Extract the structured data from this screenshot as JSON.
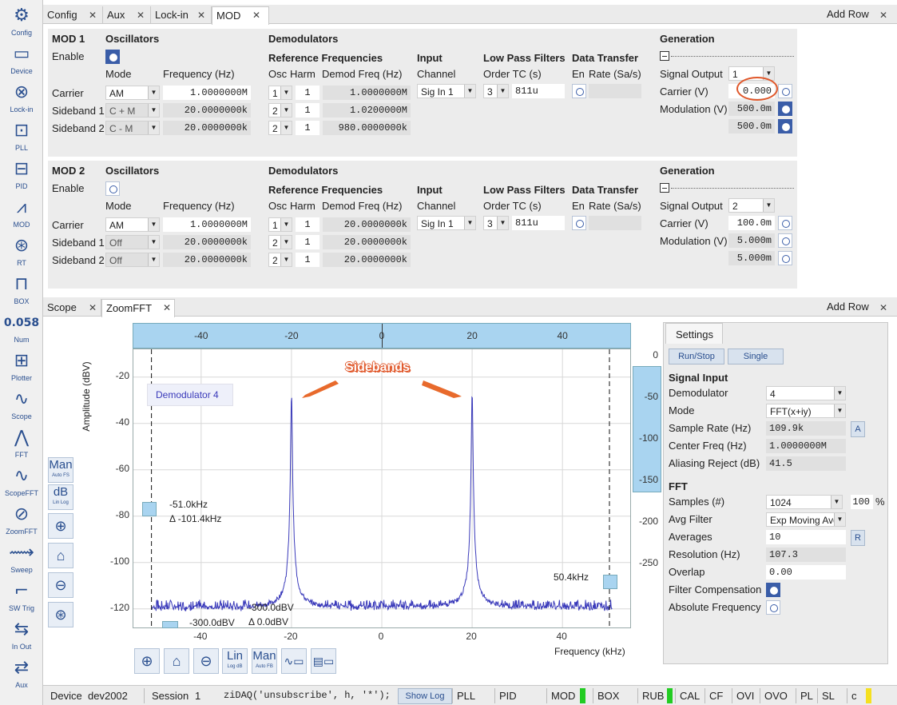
{
  "sidebar": [
    {
      "label": "Config",
      "icon": "gears-icon"
    },
    {
      "label": "Device",
      "icon": "device-icon"
    },
    {
      "label": "Lock-in",
      "icon": "lockin-icon"
    },
    {
      "label": "PLL",
      "icon": "pll-icon"
    },
    {
      "label": "PID",
      "icon": "pid-icon"
    },
    {
      "label": "MOD",
      "icon": "mod-icon"
    },
    {
      "label": "RT",
      "icon": "rt-icon"
    },
    {
      "label": "BOX",
      "icon": "box-icon"
    },
    {
      "label": "Num",
      "icon": "numeric-icon",
      "glyph": "0.058"
    },
    {
      "label": "Plotter",
      "icon": "plotter-icon"
    },
    {
      "label": "Scope",
      "icon": "scope-icon"
    },
    {
      "label": "FFT",
      "icon": "fft-icon"
    },
    {
      "label": "ScopeFFT",
      "icon": "scopefft-icon"
    },
    {
      "label": "ZoomFFT",
      "icon": "zoomfft-icon"
    },
    {
      "label": "Sweep",
      "icon": "sweep-icon"
    },
    {
      "label": "SW Trig",
      "icon": "swtrig-icon"
    },
    {
      "label": "In Out",
      "icon": "inout-icon"
    },
    {
      "label": "Aux",
      "icon": "aux-icon"
    }
  ],
  "top_tabs": {
    "tabs": [
      "Config",
      "Aux",
      "Lock-in",
      "MOD"
    ],
    "active": "MOD",
    "add_row": "Add Row"
  },
  "headers": {
    "oscillators": "Oscillators",
    "demodulators": "Demodulators",
    "generation": "Generation",
    "enable": "Enable",
    "mode": "Mode",
    "frequency": "Frequency (Hz)",
    "ref_freq": "Reference Frequencies",
    "input": "Input",
    "lpf": "Low Pass Filters",
    "data_transfer": "Data Transfer",
    "osc": "Osc",
    "harm": "Harm",
    "demod_freq": "Demod Freq (Hz)",
    "channel": "Channel",
    "order_tc": "Order TC (s)",
    "en": "En",
    "rate": "Rate (Sa/s)",
    "signal_output": "Signal Output",
    "carrier_v": "Carrier (V)",
    "modulation_v": "Modulation (V)"
  },
  "mod1": {
    "title": "MOD 1",
    "enabled": true,
    "rows": [
      {
        "label": "Carrier",
        "mode": "AM",
        "freq": "1.0000000M",
        "osc": "1",
        "harm": "1",
        "demod_freq": "1.0000000M"
      },
      {
        "label": "Sideband 1",
        "mode": "C + M",
        "freq": "20.0000000k",
        "osc": "2",
        "harm": "1",
        "demod_freq": "1.0200000M"
      },
      {
        "label": "Sideband 2",
        "mode": "C - M",
        "freq": "20.0000000k",
        "osc": "2",
        "harm": "1",
        "demod_freq": "980.0000000k"
      }
    ],
    "channel": "Sig In 1",
    "order": "3",
    "tc": "811u",
    "signal_output": "1",
    "carrier_v": "0.000",
    "modulation_v": "500.0m",
    "modulation2_v": "500.0m"
  },
  "mod2": {
    "title": "MOD 2",
    "enabled": false,
    "rows": [
      {
        "label": "Carrier",
        "mode": "AM",
        "freq": "1.0000000M",
        "osc": "1",
        "harm": "1",
        "demod_freq": "20.0000000k"
      },
      {
        "label": "Sideband 1",
        "mode": "Off",
        "freq": "20.0000000k",
        "osc": "2",
        "harm": "1",
        "demod_freq": "20.0000000k"
      },
      {
        "label": "Sideband 2",
        "mode": "Off",
        "freq": "20.0000000k",
        "osc": "2",
        "harm": "1",
        "demod_freq": "20.0000000k"
      }
    ],
    "channel": "Sig In 1",
    "order": "3",
    "tc": "811u",
    "signal_output": "2",
    "carrier_v": "100.0m",
    "modulation_v": "5.000m",
    "modulation2_v": "5.000m"
  },
  "bottom_tabs": {
    "tabs": [
      "Scope",
      "ZoomFFT"
    ],
    "active": "ZoomFFT",
    "add_row": "Add Row"
  },
  "plot": {
    "ylabel": "Amplitude (dBV)",
    "xlabel": "Frequency (kHz)",
    "annotation": "Sidebands",
    "legend": "Demodulator 4",
    "cursor1_freq": "-51.0kHz",
    "cursor1_delta": "Δ -101.4kHz",
    "cursor2_freq": "50.4kHz",
    "cursor_bottom1": "-300.0dBV",
    "cursor_bottom2": "-300.0dBV",
    "cursor_bottom_delta": "Δ 0.0dBV",
    "left_tools": [
      {
        "top": "Man",
        "sub": "Auto FS",
        "name": "man-button"
      },
      {
        "top": "dB",
        "sub": "Lin Log",
        "name": "db-button"
      }
    ],
    "bottom_tools": [
      {
        "top": "Lin",
        "sub": "Log dB",
        "name": "lin-button"
      },
      {
        "top": "Man",
        "sub": "Auto FB",
        "name": "man-x-button"
      }
    ]
  },
  "chart_data": {
    "type": "line",
    "xlabel": "Frequency (kHz)",
    "ylabel": "Amplitude (dBV)",
    "xlim": [
      -55,
      55
    ],
    "ylim": [
      -128,
      -8
    ],
    "xticks": [
      -40,
      -20,
      0,
      20,
      40
    ],
    "yticks": [
      -20,
      -40,
      -60,
      -80,
      -100,
      -120
    ],
    "right_yticks": [
      0,
      -50,
      -100,
      -150,
      -200,
      -250
    ],
    "series": [
      {
        "noise_floor": -120,
        "peaks": [
          {
            "x": -20,
            "y": -22
          },
          {
            "x": 20,
            "y": -22
          }
        ]
      }
    ],
    "cursors_x": [
      -51.0,
      50.4
    ],
    "color": "#3a3aba"
  },
  "settings": {
    "tab": "Settings",
    "run_stop": "Run/Stop",
    "single": "Single",
    "signal_input": "Signal Input",
    "fft": "FFT",
    "rows": [
      {
        "label": "Demodulator",
        "value": "4",
        "type": "select"
      },
      {
        "label": "Mode",
        "value": "FFT(x+iy)",
        "type": "select"
      },
      {
        "label": "Sample Rate (Hz)",
        "value": "109.9k",
        "type": "ro",
        "btn": "A"
      },
      {
        "label": "Center Freq (Hz)",
        "value": "1.0000000M",
        "type": "ro"
      },
      {
        "label": "Aliasing Reject (dB)",
        "value": "41.5",
        "type": "ro"
      }
    ],
    "fft_rows": [
      {
        "label": "Samples (#)",
        "value": "1024",
        "type": "select",
        "extra": "100",
        "unit": "%"
      },
      {
        "label": "Avg Filter",
        "value": "Exp Moving Avg",
        "type": "select"
      },
      {
        "label": "Averages",
        "value": "10",
        "type": "field",
        "btn": "R"
      },
      {
        "label": "Resolution (Hz)",
        "value": "107.3",
        "type": "ro"
      },
      {
        "label": "Overlap",
        "value": "0.00",
        "type": "field"
      },
      {
        "label": "Filter Compensation",
        "type": "radio",
        "on": true
      },
      {
        "label": "Absolute Frequency",
        "type": "radio",
        "on": false
      }
    ]
  },
  "status": {
    "device_label": "Device",
    "device": "dev2002",
    "session_label": "Session",
    "session": "1",
    "command": "ziDAQ('unsubscribe', h, '*');",
    "show_log": "Show Log",
    "flags": [
      "PLL",
      "PID",
      "MOD",
      "BOX",
      "RUB",
      "CAL",
      "CF",
      "OVI",
      "OVO",
      "PL",
      "SL",
      "c"
    ]
  }
}
